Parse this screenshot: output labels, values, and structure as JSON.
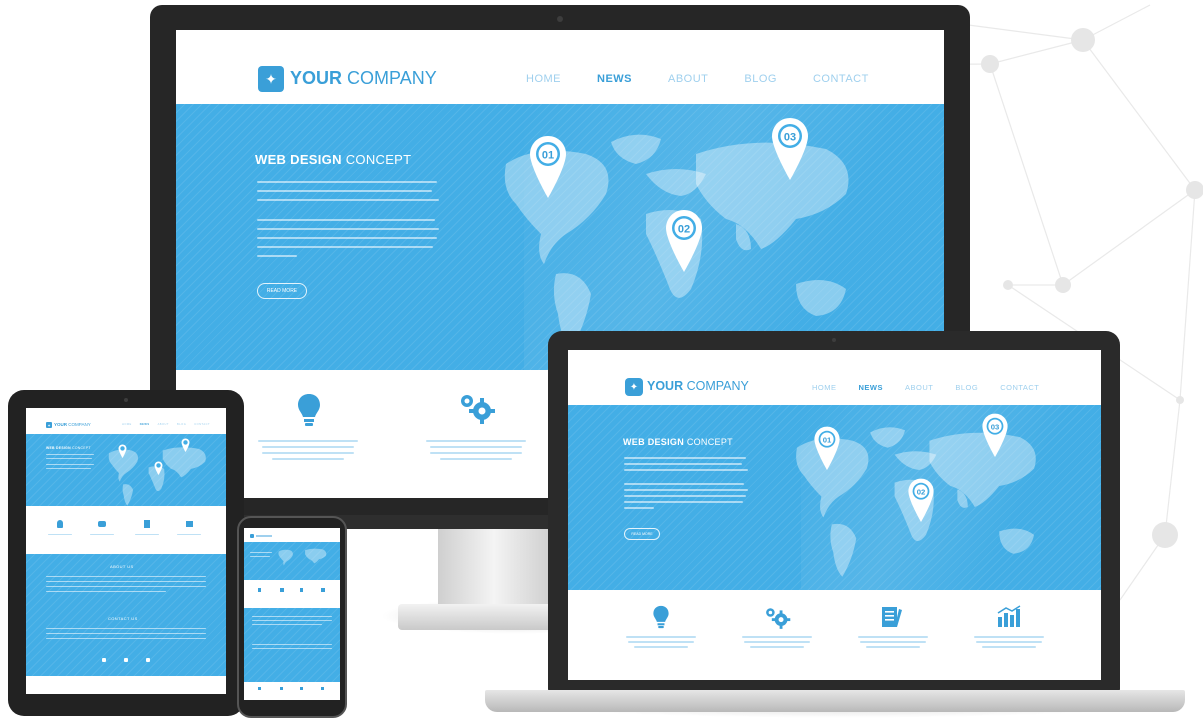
{
  "brand": {
    "name_bold": "YOUR",
    "name_rest": "COMPANY"
  },
  "nav": {
    "items": [
      "HOME",
      "NEWS",
      "ABOUT",
      "BLOG",
      "CONTACT"
    ],
    "active": "NEWS"
  },
  "hero": {
    "title_bold": "WEB DESIGN",
    "title_rest": "CONCEPT",
    "button": "READ MORE"
  },
  "map": {
    "pins": [
      "01",
      "02",
      "03"
    ]
  },
  "features": {
    "icons": [
      "lightbulb-icon",
      "gears-icon",
      "document-icon",
      "bar-chart-icon"
    ]
  },
  "sections": {
    "about": "ABOUT US",
    "contact": "CONTACT US"
  },
  "colors": {
    "brand": "#3a9fd8",
    "hero": "#43aee6",
    "device_frame": "#262626"
  }
}
